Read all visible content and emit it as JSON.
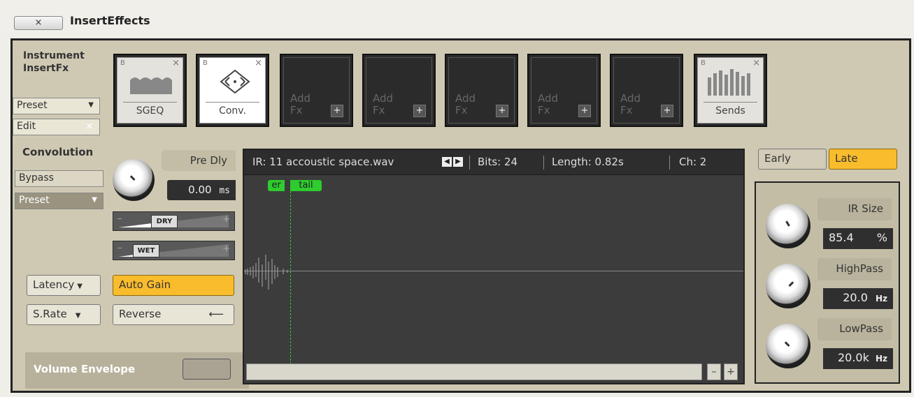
{
  "window": {
    "title": "InsertEffects",
    "close_label": "×"
  },
  "instrument": {
    "label_line1": "Instrument",
    "label_line2": "InsertFx",
    "preset_label": "Preset",
    "edit_label": "Edit"
  },
  "slots": [
    {
      "name": "SGEQ",
      "flag": "B",
      "close": "×",
      "state": "loaded"
    },
    {
      "name": "Conv.",
      "flag": "B",
      "close": "×",
      "state": "active"
    },
    {
      "add_line1": "Add",
      "add_line2": "Fx",
      "plus": "+",
      "state": "empty"
    },
    {
      "add_line1": "Add",
      "add_line2": "Fx",
      "plus": "+",
      "state": "empty"
    },
    {
      "add_line1": "Add",
      "add_line2": "Fx",
      "plus": "+",
      "state": "empty"
    },
    {
      "add_line1": "Add",
      "add_line2": "Fx",
      "plus": "+",
      "state": "empty"
    },
    {
      "add_line1": "Add",
      "add_line2": "Fx",
      "plus": "+",
      "state": "empty"
    },
    {
      "name": "Sends",
      "flag": "B",
      "close": "×",
      "state": "loaded"
    }
  ],
  "convolution": {
    "title": "Convolution",
    "bypass_label": "Bypass",
    "preset_label": "Preset",
    "predly_label": "Pre Dly",
    "predly_value": "0.00",
    "predly_unit": "ms",
    "dry_label": "DRY",
    "wet_label": "WET",
    "slider_minus": "–",
    "slider_plus": "+",
    "latency_label": "Latency",
    "autogain_label": "Auto Gain",
    "srate_label": "S.Rate",
    "reverse_label": "Reverse",
    "volenv_label": "Volume Envelope"
  },
  "ir": {
    "file": "IR: 11 accoustic space.wav",
    "bits": "Bits: 24",
    "length": "Length: 0.82s",
    "channels": "Ch: 2",
    "er_label": "er",
    "tail_label": "tail",
    "zoom_minus": "–",
    "zoom_plus": "+"
  },
  "right": {
    "early_label": "Early",
    "late_label": "Late",
    "irsize_label": "IR Size",
    "irsize_value": "85.4",
    "irsize_unit": "%",
    "highpass_label": "HighPass",
    "highpass_value": "20.0",
    "highpass_unit": "Hz",
    "lowpass_label": "LowPass",
    "lowpass_value": "20.0k",
    "lowpass_unit": "Hz"
  },
  "colors": {
    "accent": "#f9bc2c",
    "marker": "#2ecc2e",
    "panel": "#cfc9b3"
  }
}
